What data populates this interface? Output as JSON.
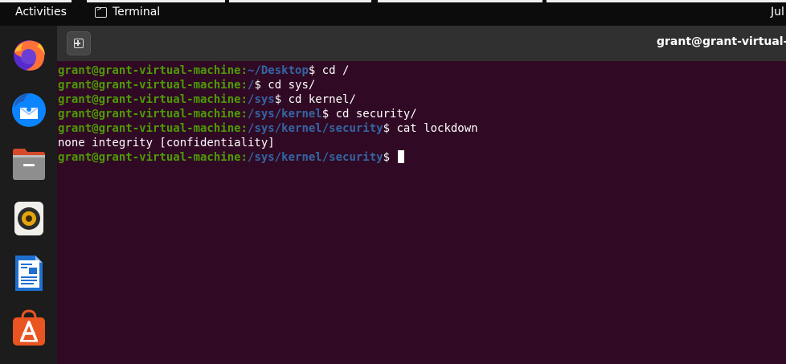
{
  "topbar": {
    "activities": "Activities",
    "app_name": "Terminal",
    "clock": "Jul"
  },
  "dock": {
    "items": [
      {
        "name": "firefox-icon"
      },
      {
        "name": "thunderbird-icon"
      },
      {
        "name": "files-icon"
      },
      {
        "name": "rhythmbox-icon"
      },
      {
        "name": "libreoffice-writer-icon"
      },
      {
        "name": "software-store-icon"
      }
    ]
  },
  "terminal": {
    "title": "grant@grant-virtual-ma",
    "colors": {
      "background": "#300a24",
      "user": "#4e9a06",
      "path": "#3465a4"
    },
    "lines": [
      {
        "user": "grant@grant-virtual-machine",
        "sep": ":",
        "path": "~/Desktop",
        "cmd": "$ cd /"
      },
      {
        "user": "grant@grant-virtual-machine",
        "sep": ":",
        "path": "/",
        "cmd": "$ cd sys/"
      },
      {
        "user": "grant@grant-virtual-machine",
        "sep": ":",
        "path": "/sys",
        "cmd": "$ cd kernel/"
      },
      {
        "user": "grant@grant-virtual-machine",
        "sep": ":",
        "path": "/sys/kernel",
        "cmd": "$ cd security/"
      },
      {
        "user": "grant@grant-virtual-machine",
        "sep": ":",
        "path": "/sys/kernel/security",
        "cmd": "$ cat lockdown"
      },
      {
        "output": "none integrity [confidentiality]"
      },
      {
        "user": "grant@grant-virtual-machine",
        "sep": ":",
        "path": "/sys/kernel/security",
        "cmd": "$ "
      }
    ]
  }
}
